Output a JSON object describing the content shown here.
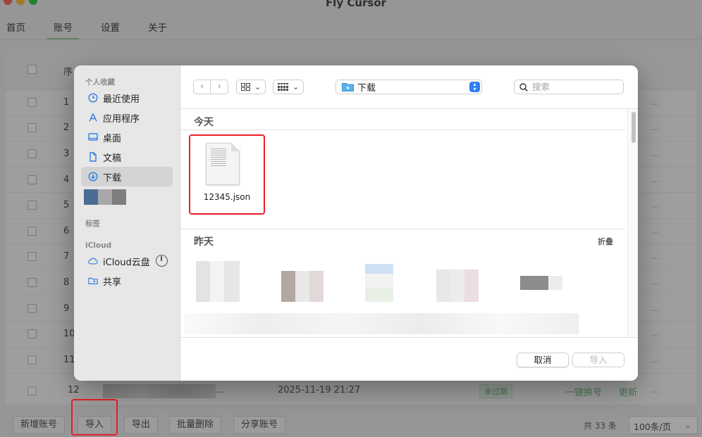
{
  "app": {
    "title": "Fly Cursor",
    "tabs": [
      {
        "label": "首页"
      },
      {
        "label": "账号"
      },
      {
        "label": "设置"
      },
      {
        "label": "关于"
      }
    ],
    "table": {
      "header_no": "序",
      "row_numbers": [
        "1",
        "2",
        "3",
        "4",
        "5",
        "6",
        "7",
        "8",
        "9",
        "10",
        "11"
      ],
      "last_row": {
        "no": "12",
        "ellipsis": "...",
        "date": "2025-11-19 21:27",
        "badge": "未过期",
        "action_switch": "一键换号",
        "action_refresh": "更新",
        "more": "..."
      }
    },
    "footer": {
      "add": "新增账号",
      "import": "导入",
      "export": "导出",
      "batch_delete": "批量删除",
      "share": "分享账号",
      "total": "共 33 条",
      "page_size": "100条/页"
    }
  },
  "dialog": {
    "sidebar": {
      "favorites_header": "个人收藏",
      "favorites": [
        {
          "label": "最近使用",
          "icon": "clock-icon"
        },
        {
          "label": "应用程序",
          "icon": "apps-icon"
        },
        {
          "label": "桌面",
          "icon": "desktop-icon"
        },
        {
          "label": "文稿",
          "icon": "document-icon"
        },
        {
          "label": "下载",
          "icon": "download-icon",
          "selected": true
        }
      ],
      "tags_header": "标签",
      "icloud_header": "iCloud",
      "icloud": [
        {
          "label": "iCloud云盘",
          "icon": "cloud-icon"
        },
        {
          "label": "共享",
          "icon": "shared-folder-icon"
        }
      ]
    },
    "toolbar": {
      "back": "‹",
      "forward": "›",
      "location": "下载",
      "search_placeholder": "搜索"
    },
    "sections": {
      "today": "今天",
      "yesterday": "昨天",
      "collapse": "折叠"
    },
    "files_today": [
      {
        "name": "12345.json"
      }
    ],
    "buttons": {
      "cancel": "取消",
      "open": "导入"
    }
  },
  "colors": {
    "accent_blue": "#2f7ef6",
    "highlight_red": "#ea1f28",
    "brand_green": "#67b57a"
  }
}
